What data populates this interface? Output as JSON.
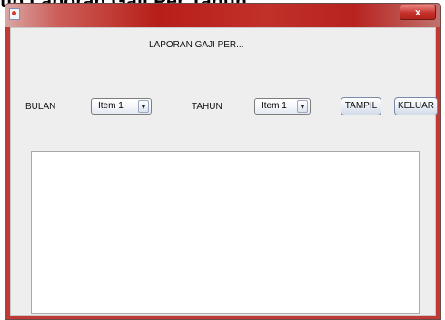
{
  "banner": {
    "text": "tip Laporan Gaji Per Tahun"
  },
  "window": {
    "close_label": "x"
  },
  "form": {
    "title": "LAPORAN GAJI PER...",
    "bulan_label": "BULAN",
    "bulan_value": "Item 1",
    "tahun_label": "TAHUN",
    "tahun_value": "Item 1",
    "tampil_label": "TAMPIL",
    "keluar_label": "KELUAR"
  }
}
